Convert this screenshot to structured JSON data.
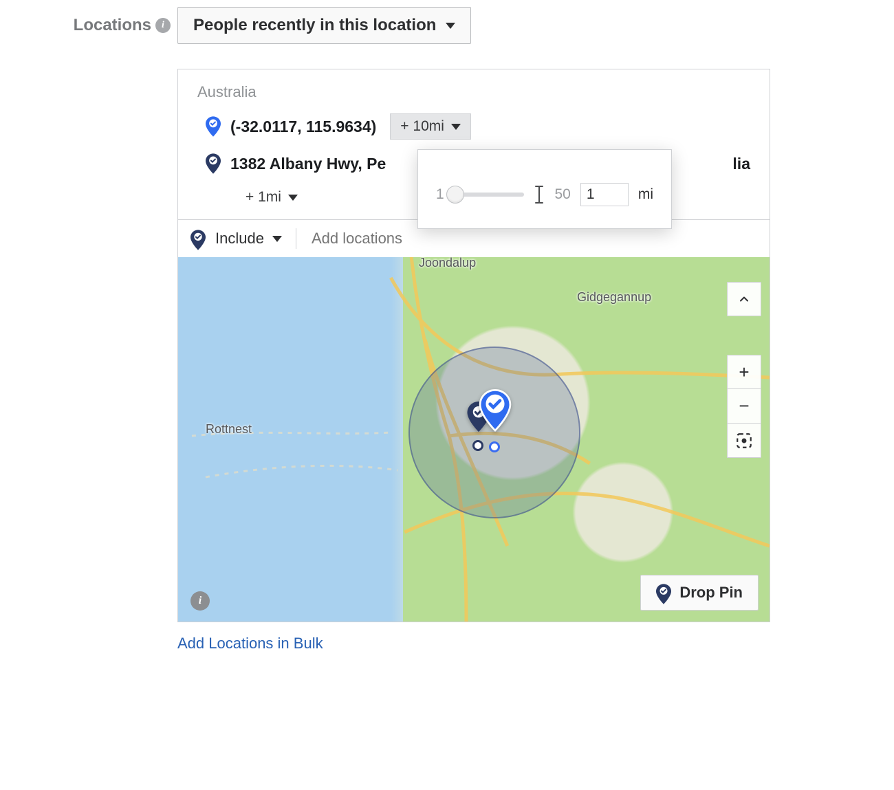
{
  "section_label": "Locations",
  "audience_dropdown": {
    "selected": "People recently in this location"
  },
  "country_group": "Australia",
  "locations": [
    {
      "name": "(-32.0117, 115.9634)",
      "radius_label": "+ 10mi",
      "pin_color": "blue-checked"
    },
    {
      "name": "1382 Albany Hwy, Pe",
      "name_suffix_visible": "lia",
      "radius_label": "+ 1mi",
      "pin_color": "navy"
    }
  ],
  "radius_popover": {
    "min": "1",
    "max": "50",
    "value": "1",
    "unit": "mi"
  },
  "include_bar": {
    "mode": "Include",
    "placeholder": "Add locations"
  },
  "map": {
    "labels": {
      "joondalup": "Joondalup",
      "gidgegannup": "Gidgegannup",
      "rottnest": "Rottnest"
    },
    "drop_pin": "Drop Pin"
  },
  "bulk_link": "Add Locations in Bulk"
}
